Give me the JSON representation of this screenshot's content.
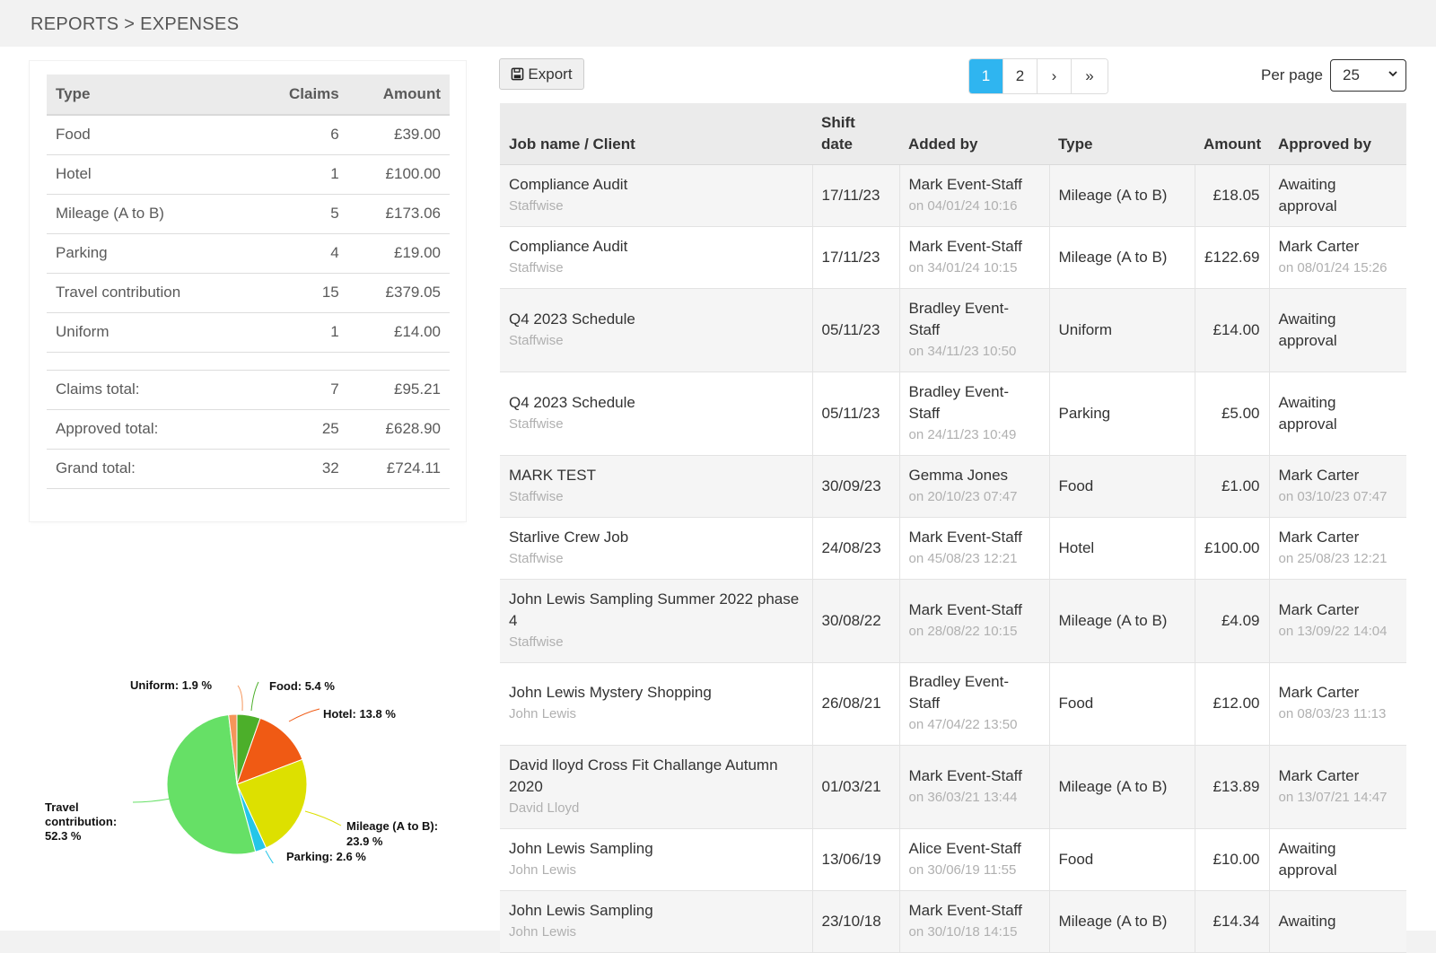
{
  "breadcrumb": "REPORTS > EXPENSES",
  "summary": {
    "headers": {
      "type": "Type",
      "claims": "Claims",
      "amount": "Amount"
    },
    "rows": [
      {
        "type": "Food",
        "claims": "6",
        "amount": "£39.00"
      },
      {
        "type": "Hotel",
        "claims": "1",
        "amount": "£100.00"
      },
      {
        "type": "Mileage (A to B)",
        "claims": "5",
        "amount": "£173.06"
      },
      {
        "type": "Parking",
        "claims": "4",
        "amount": "£19.00"
      },
      {
        "type": "Travel contribution",
        "claims": "15",
        "amount": "£379.05"
      },
      {
        "type": "Uniform",
        "claims": "1",
        "amount": "£14.00"
      }
    ],
    "totals": [
      {
        "label": "Claims total:",
        "claims": "7",
        "amount": "£95.21"
      },
      {
        "label": "Approved total:",
        "claims": "25",
        "amount": "£628.90"
      },
      {
        "label": "Grand total:",
        "claims": "32",
        "amount": "£724.11"
      }
    ]
  },
  "chart_data": {
    "type": "pie",
    "slices": [
      {
        "label": "Food",
        "value": 5.4,
        "text": "Food: 5.4 %",
        "color": "#4caf2a"
      },
      {
        "label": "Hotel",
        "value": 13.8,
        "text": "Hotel: 13.8 %",
        "color": "#f05a14"
      },
      {
        "label": "Mileage (A to B)",
        "value": 23.9,
        "text": "Mileage (A to B): 23.9 %",
        "color": "#dde000"
      },
      {
        "label": "Parking",
        "value": 2.6,
        "text": "Parking: 2.6 %",
        "color": "#25c6e8"
      },
      {
        "label": "Travel contribution",
        "value": 52.3,
        "text": "Travel contribution: 52.3 %",
        "color": "#66e066"
      },
      {
        "label": "Uniform",
        "value": 1.9,
        "text": "Uniform: 1.9 %",
        "color": "#f5955a"
      }
    ],
    "labels": {
      "food": "Food: 5.4 %",
      "hotel": "Hotel: 13.8 %",
      "mileage_1": "Mileage (A to B):",
      "mileage_2": "23.9 %",
      "parking": "Parking: 2.6 %",
      "travel_1": "Travel",
      "travel_2": "contribution:",
      "travel_3": "52.3 %",
      "uniform": "Uniform: 1.9 %"
    }
  },
  "toolbar": {
    "export_label": "Export",
    "pages": [
      "1",
      "2",
      "›",
      "»"
    ],
    "active_page": "1",
    "per_page_label": "Per page",
    "per_page_value": "25"
  },
  "table": {
    "headers": {
      "job": "Job name / Client",
      "shift_1": "Shift",
      "shift_2": "date",
      "added_by": "Added by",
      "type": "Type",
      "amount": "Amount",
      "approved_by": "Approved by"
    },
    "rows": [
      {
        "job": "Compliance Audit",
        "client": "Staffwise",
        "shift": "17/11/23",
        "added": "Mark Event-Staff",
        "added_on": "on 04/01/24 10:16",
        "type": "Mileage (A to B)",
        "amount": "£18.05",
        "approved": "Awaiting approval",
        "approved_on": ""
      },
      {
        "job": "Compliance Audit",
        "client": "Staffwise",
        "shift": "17/11/23",
        "added": "Mark Event-Staff",
        "added_on": "on 34/01/24 10:15",
        "type": "Mileage (A to B)",
        "amount": "£122.69",
        "approved": "Mark Carter",
        "approved_on": "on 08/01/24 15:26"
      },
      {
        "job": "Q4 2023 Schedule",
        "client": "Staffwise",
        "shift": "05/11/23",
        "added": "Bradley Event-Staff",
        "added_on": "on 34/11/23 10:50",
        "type": "Uniform",
        "amount": "£14.00",
        "approved": "Awaiting approval",
        "approved_on": ""
      },
      {
        "job": "Q4 2023 Schedule",
        "client": "Staffwise",
        "shift": "05/11/23",
        "added": "Bradley Event-Staff",
        "added_on": "on 24/11/23 10:49",
        "type": "Parking",
        "amount": "£5.00",
        "approved": "Awaiting approval",
        "approved_on": ""
      },
      {
        "job": "MARK TEST",
        "client": "Staffwise",
        "shift": "30/09/23",
        "added": "Gemma Jones",
        "added_on": "on 20/10/23 07:47",
        "type": "Food",
        "amount": "£1.00",
        "approved": "Mark Carter",
        "approved_on": "on 03/10/23 07:47"
      },
      {
        "job": "Starlive Crew Job",
        "client": "Staffwise",
        "shift": "24/08/23",
        "added": "Mark Event-Staff",
        "added_on": "on 45/08/23 12:21",
        "type": "Hotel",
        "amount": "£100.00",
        "approved": "Mark Carter",
        "approved_on": "on 25/08/23 12:21"
      },
      {
        "job": "John Lewis Sampling Summer 2022 phase 4",
        "client": "Staffwise",
        "shift": "30/08/22",
        "added": "Mark Event-Staff",
        "added_on": "on 28/08/22 10:15",
        "type": "Mileage (A to B)",
        "amount": "£4.09",
        "approved": "Mark Carter",
        "approved_on": "on 13/09/22 14:04"
      },
      {
        "job": "John Lewis Mystery Shopping",
        "client": "John Lewis",
        "shift": "26/08/21",
        "added": "Bradley Event-Staff",
        "added_on": "on 47/04/22 13:50",
        "type": "Food",
        "amount": "£12.00",
        "approved": "Mark Carter",
        "approved_on": "on 08/03/23 11:13"
      },
      {
        "job": "David lloyd Cross Fit Challange Autumn 2020",
        "client": "David Lloyd",
        "shift": "01/03/21",
        "added": "Mark Event-Staff",
        "added_on": "on 36/03/21 13:44",
        "type": "Mileage (A to B)",
        "amount": "£13.89",
        "approved": "Mark Carter",
        "approved_on": "on 13/07/21 14:47"
      },
      {
        "job": "John Lewis Sampling",
        "client": "John Lewis",
        "shift": "13/06/19",
        "added": "Alice Event-Staff",
        "added_on": "on 30/06/19 11:55",
        "type": "Food",
        "amount": "£10.00",
        "approved": "Awaiting approval",
        "approved_on": ""
      },
      {
        "job": "John Lewis Sampling",
        "client": "John Lewis",
        "shift": "23/10/18",
        "added": "Mark Event-Staff",
        "added_on": "on 30/10/18 14:15",
        "type": "Mileage (A to B)",
        "amount": "£14.34",
        "approved": "Awaiting",
        "approved_on": ""
      }
    ]
  }
}
